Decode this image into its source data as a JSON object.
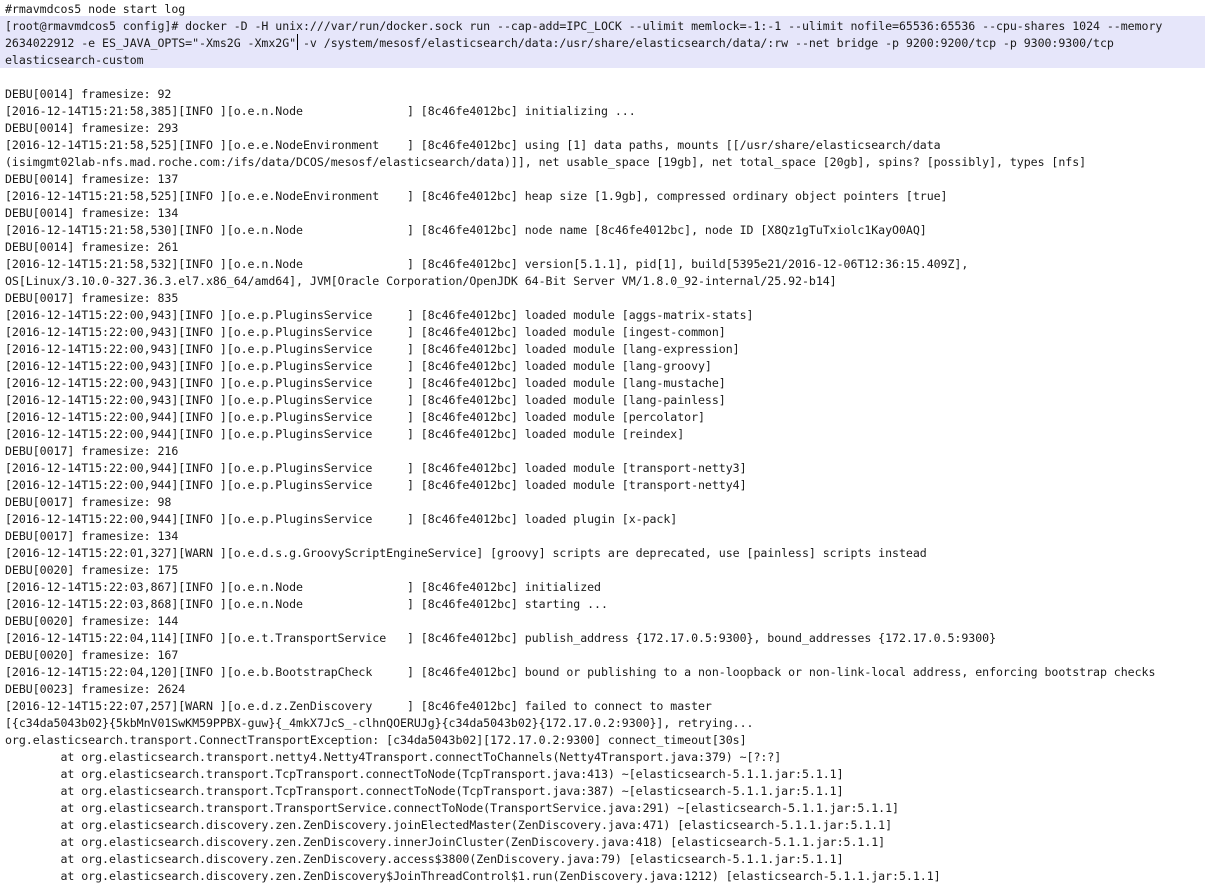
{
  "editor": {
    "highlight_color": "#e6e6fa",
    "lines": [
      "#rmavmdcos5 node start log",
      "[root@rmavmdcos5 config]# docker -D -H unix:///var/run/docker.sock run --cap-add=IPC_LOCK --ulimit memlock=-1:-1 --ulimit nofile=65536:65536 --cpu-shares 1024 --memory",
      "2634022912 -e ES_JAVA_OPTS=\"-Xms2G -Xmx2G\" -v /system/mesosf/elasticsearch/data:/usr/share/elasticsearch/data/:rw --net bridge -p 9200:9200/tcp -p 9300:9300/tcp",
      "elasticsearch-custom",
      "",
      "DEBU[0014] framesize: 92",
      "[2016-12-14T15:21:58,385][INFO ][o.e.n.Node               ] [8c46fe4012bc] initializing ...",
      "DEBU[0014] framesize: 293",
      "[2016-12-14T15:21:58,525][INFO ][o.e.e.NodeEnvironment    ] [8c46fe4012bc] using [1] data paths, mounts [[/usr/share/elasticsearch/data",
      "(isimgmt02lab-nfs.mad.roche.com:/ifs/data/DCOS/mesosf/elasticsearch/data)]], net usable_space [19gb], net total_space [20gb], spins? [possibly], types [nfs]",
      "DEBU[0014] framesize: 137",
      "[2016-12-14T15:21:58,525][INFO ][o.e.e.NodeEnvironment    ] [8c46fe4012bc] heap size [1.9gb], compressed ordinary object pointers [true]",
      "DEBU[0014] framesize: 134",
      "[2016-12-14T15:21:58,530][INFO ][o.e.n.Node               ] [8c46fe4012bc] node name [8c46fe4012bc], node ID [X8Qz1gTuTxiolc1KayO0AQ]",
      "DEBU[0014] framesize: 261",
      "[2016-12-14T15:21:58,532][INFO ][o.e.n.Node               ] [8c46fe4012bc] version[5.1.1], pid[1], build[5395e21/2016-12-06T12:36:15.409Z],",
      "OS[Linux/3.10.0-327.36.3.el7.x86_64/amd64], JVM[Oracle Corporation/OpenJDK 64-Bit Server VM/1.8.0_92-internal/25.92-b14]",
      "DEBU[0017] framesize: 835",
      "[2016-12-14T15:22:00,943][INFO ][o.e.p.PluginsService     ] [8c46fe4012bc] loaded module [aggs-matrix-stats]",
      "[2016-12-14T15:22:00,943][INFO ][o.e.p.PluginsService     ] [8c46fe4012bc] loaded module [ingest-common]",
      "[2016-12-14T15:22:00,943][INFO ][o.e.p.PluginsService     ] [8c46fe4012bc] loaded module [lang-expression]",
      "[2016-12-14T15:22:00,943][INFO ][o.e.p.PluginsService     ] [8c46fe4012bc] loaded module [lang-groovy]",
      "[2016-12-14T15:22:00,943][INFO ][o.e.p.PluginsService     ] [8c46fe4012bc] loaded module [lang-mustache]",
      "[2016-12-14T15:22:00,943][INFO ][o.e.p.PluginsService     ] [8c46fe4012bc] loaded module [lang-painless]",
      "[2016-12-14T15:22:00,944][INFO ][o.e.p.PluginsService     ] [8c46fe4012bc] loaded module [percolator]",
      "[2016-12-14T15:22:00,944][INFO ][o.e.p.PluginsService     ] [8c46fe4012bc] loaded module [reindex]",
      "DEBU[0017] framesize: 216",
      "[2016-12-14T15:22:00,944][INFO ][o.e.p.PluginsService     ] [8c46fe4012bc] loaded module [transport-netty3]",
      "[2016-12-14T15:22:00,944][INFO ][o.e.p.PluginsService     ] [8c46fe4012bc] loaded module [transport-netty4]",
      "DEBU[0017] framesize: 98",
      "[2016-12-14T15:22:00,944][INFO ][o.e.p.PluginsService     ] [8c46fe4012bc] loaded plugin [x-pack]",
      "DEBU[0017] framesize: 134",
      "[2016-12-14T15:22:01,327][WARN ][o.e.d.s.g.GroovyScriptEngineService] [groovy] scripts are deprecated, use [painless] scripts instead",
      "DEBU[0020] framesize: 175",
      "[2016-12-14T15:22:03,867][INFO ][o.e.n.Node               ] [8c46fe4012bc] initialized",
      "[2016-12-14T15:22:03,868][INFO ][o.e.n.Node               ] [8c46fe4012bc] starting ...",
      "DEBU[0020] framesize: 144",
      "[2016-12-14T15:22:04,114][INFO ][o.e.t.TransportService   ] [8c46fe4012bc] publish_address {172.17.0.5:9300}, bound_addresses {172.17.0.5:9300}",
      "DEBU[0020] framesize: 167",
      "[2016-12-14T15:22:04,120][INFO ][o.e.b.BootstrapCheck     ] [8c46fe4012bc] bound or publishing to a non-loopback or non-link-local address, enforcing bootstrap checks",
      "DEBU[0023] framesize: 2624",
      "[2016-12-14T15:22:07,257][WARN ][o.e.d.z.ZenDiscovery     ] [8c46fe4012bc] failed to connect to master",
      "[{c34da5043b02}{5kbMnV01SwKM59PPBX-guw}{_4mkX7JcS_-clhnQOERUJg}{c34da5043b02}{172.17.0.2:9300}], retrying...",
      "org.elasticsearch.transport.ConnectTransportException: [c34da5043b02][172.17.0.2:9300] connect_timeout[30s]",
      "        at org.elasticsearch.transport.netty4.Netty4Transport.connectToChannels(Netty4Transport.java:379) ~[?:?]",
      "        at org.elasticsearch.transport.TcpTransport.connectToNode(TcpTransport.java:413) ~[elasticsearch-5.1.1.jar:5.1.1]",
      "        at org.elasticsearch.transport.TcpTransport.connectToNode(TcpTransport.java:387) ~[elasticsearch-5.1.1.jar:5.1.1]",
      "        at org.elasticsearch.transport.TransportService.connectToNode(TransportService.java:291) ~[elasticsearch-5.1.1.jar:5.1.1]",
      "        at org.elasticsearch.discovery.zen.ZenDiscovery.joinElectedMaster(ZenDiscovery.java:471) [elasticsearch-5.1.1.jar:5.1.1]",
      "        at org.elasticsearch.discovery.zen.ZenDiscovery.innerJoinCluster(ZenDiscovery.java:418) [elasticsearch-5.1.1.jar:5.1.1]",
      "        at org.elasticsearch.discovery.zen.ZenDiscovery.access$3800(ZenDiscovery.java:79) [elasticsearch-5.1.1.jar:5.1.1]",
      "        at org.elasticsearch.discovery.zen.ZenDiscovery$JoinThreadControl$1.run(ZenDiscovery.java:1212) [elasticsearch-5.1.1.jar:5.1.1]"
    ]
  }
}
